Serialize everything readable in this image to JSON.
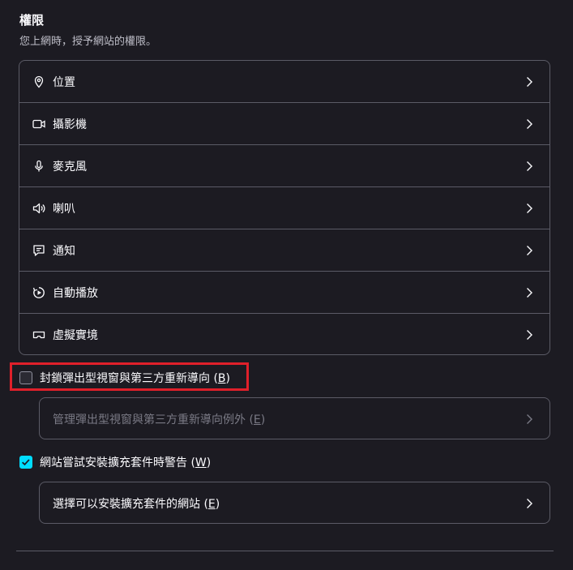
{
  "section": {
    "title": "權限",
    "subtitle": "您上網時，授予網站的權限。"
  },
  "permissions": [
    {
      "label": "位置",
      "icon": "location-icon"
    },
    {
      "label": "攝影機",
      "icon": "camera-icon"
    },
    {
      "label": "麥克風",
      "icon": "microphone-icon"
    },
    {
      "label": "喇叭",
      "icon": "speaker-icon"
    },
    {
      "label": "通知",
      "icon": "notification-icon"
    },
    {
      "label": "自動播放",
      "icon": "autoplay-icon"
    },
    {
      "label": "虛擬實境",
      "icon": "vr-headset-icon"
    }
  ],
  "popup_block": {
    "label": "封鎖彈出型視窗與第三方重新導向 (",
    "key": "B",
    "suffix": ")",
    "checked": false
  },
  "popup_exceptions": {
    "label": "管理彈出型視窗與第三方重新導向例外 (",
    "key": "E",
    "suffix": ")",
    "disabled": true
  },
  "addon_warn": {
    "label": "網站嘗試安裝擴充套件時警告 (",
    "key": "W",
    "suffix": ")",
    "checked": true
  },
  "addon_sites": {
    "label": "選擇可以安裝擴充套件的網站 (",
    "key": "E",
    "suffix": ")"
  },
  "colors": {
    "accent": "#00ddff",
    "highlight": "#e0202a",
    "background": "#1c1b22"
  }
}
